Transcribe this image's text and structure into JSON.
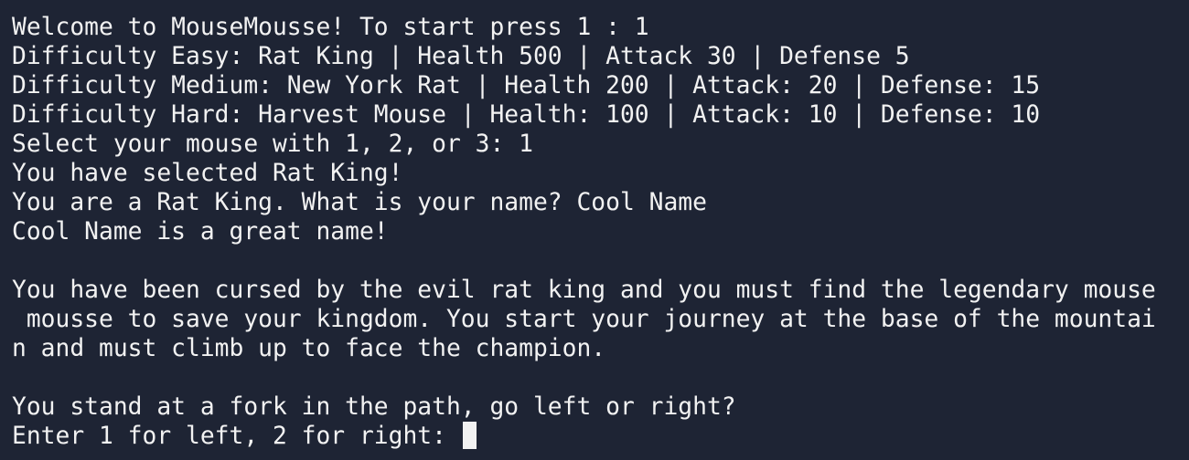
{
  "terminal": {
    "lines": [
      "Welcome to MouseMousse! To start press 1 : 1",
      "Difficulty Easy: Rat King | Health 500 | Attack 30 | Defense 5",
      "Difficulty Medium: New York Rat | Health 200 | Attack: 20 | Defense: 15",
      "Difficulty Hard: Harvest Mouse | Health: 100 | Attack: 10 | Defense: 10",
      "Select your mouse with 1, 2, or 3: 1",
      "You have selected Rat King!",
      "You are a Rat King. What is your name? Cool Name",
      "Cool Name is a great name!",
      "",
      "You have been cursed by the evil rat king and you must find the legendary mouse",
      " mousse to save your kingdom. You start your journey at the base of the mountai",
      "n and must climb up to face the champion.",
      "",
      "You stand at a fork in the path, go left or right?"
    ],
    "prompt": "Enter 1 for left, 2 for right: ",
    "colors": {
      "background": "#1e2434",
      "foreground": "#f2f2f2",
      "cursor": "#f2f2f2"
    }
  }
}
